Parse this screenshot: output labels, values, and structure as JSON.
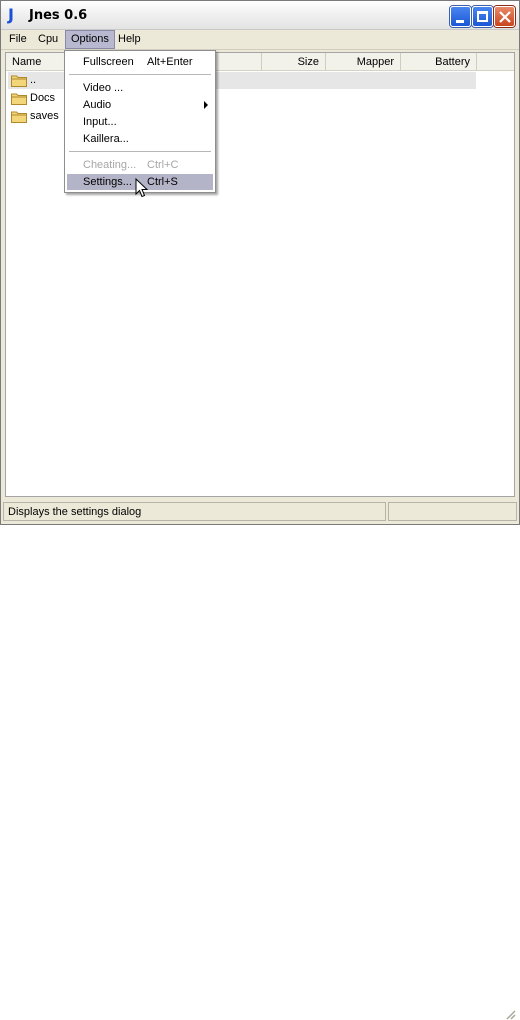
{
  "window": {
    "title": "Jnes 0.6",
    "icon_letter": "J",
    "icon_color": "#1a4fd8"
  },
  "titlebar_buttons": [
    "minimize-icon",
    "maximize-icon",
    "close-icon"
  ],
  "menubar": {
    "items": [
      {
        "label": "File"
      },
      {
        "label": "Cpu"
      },
      {
        "label": "Options",
        "active": true
      },
      {
        "label": "Help"
      }
    ]
  },
  "list": {
    "columns": [
      {
        "label": "Name"
      },
      {
        "label": "Size"
      },
      {
        "label": "Mapper"
      },
      {
        "label": "Battery"
      }
    ],
    "rows": [
      {
        "name": "..",
        "icon": "folder-icon",
        "selected": true
      },
      {
        "name": "Docs",
        "icon": "folder-icon"
      },
      {
        "name": "saves",
        "icon": "folder-icon"
      }
    ]
  },
  "options_menu": {
    "items": [
      {
        "label": "Fullscreen",
        "shortcut": "Alt+Enter"
      },
      {
        "label": "Video ..."
      },
      {
        "label": "Audio",
        "submenu": true
      },
      {
        "label": "Input..."
      },
      {
        "label": "Kaillera..."
      },
      {
        "label": "Cheating...",
        "shortcut": "Ctrl+C",
        "disabled": true
      },
      {
        "label": "Settings...",
        "shortcut": "Ctrl+S",
        "hover": true
      }
    ]
  },
  "statusbar": {
    "text": "Displays the settings dialog"
  }
}
